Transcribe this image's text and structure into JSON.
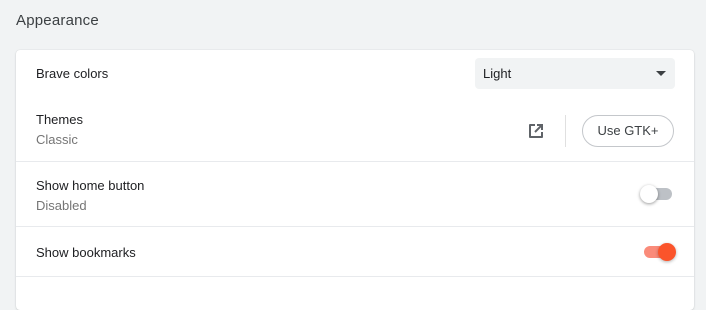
{
  "section": {
    "title": "Appearance"
  },
  "brave_colors": {
    "label": "Brave colors",
    "selected": "Light"
  },
  "themes": {
    "label": "Themes",
    "sublabel": "Classic",
    "open_icon": "open-in-new-icon",
    "button_label": "Use GTK+"
  },
  "home_button": {
    "label": "Show home button",
    "sublabel": "Disabled",
    "enabled": false
  },
  "bookmarks": {
    "label": "Show bookmarks",
    "enabled": true
  },
  "colors": {
    "accent": "#fb542b",
    "accent_track": "#fa8b7a",
    "page_bg": "#f1f3f4",
    "card_bg": "#ffffff"
  }
}
